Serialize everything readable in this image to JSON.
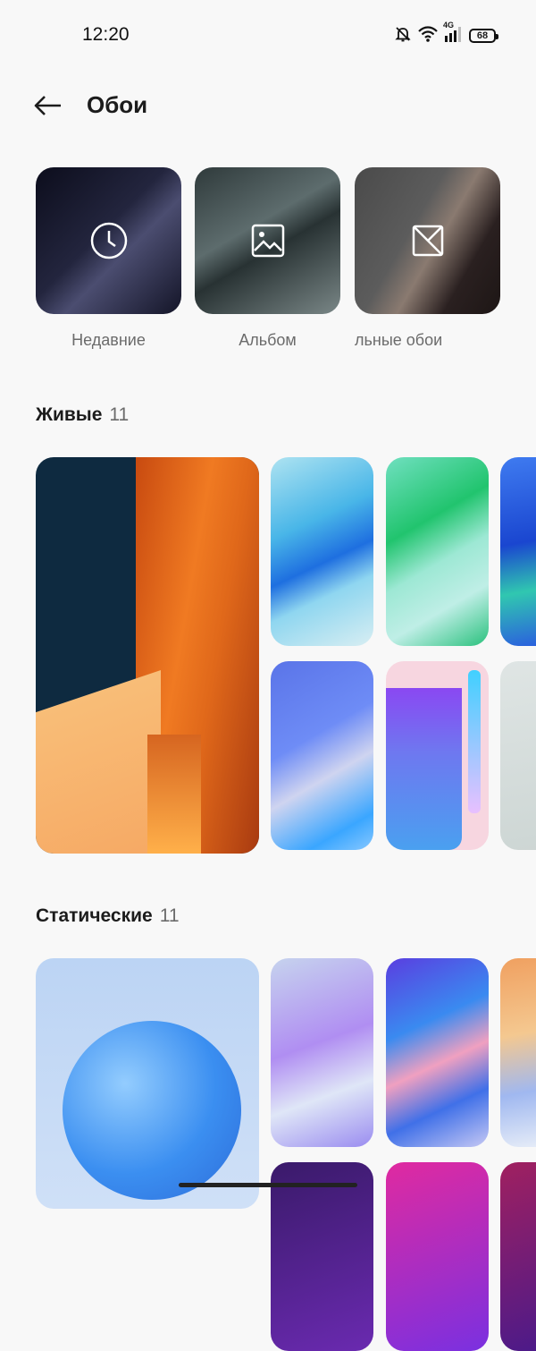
{
  "status_bar": {
    "time": "12:20",
    "battery": "68",
    "network": "4G"
  },
  "header": {
    "title": "Обои"
  },
  "categories": [
    {
      "label": "Недавние",
      "icon": "clock-icon"
    },
    {
      "label": "Альбом",
      "icon": "image-icon"
    },
    {
      "label": "льные обои",
      "icon": "crossed-frame-icon"
    }
  ],
  "sections": {
    "live": {
      "title": "Живые",
      "count": "11"
    },
    "static": {
      "title": "Статические",
      "count": "11"
    }
  },
  "colors": {
    "background": "#f8f8f8",
    "text": "#1c1c1c",
    "secondary_text": "#6b6b6b"
  }
}
